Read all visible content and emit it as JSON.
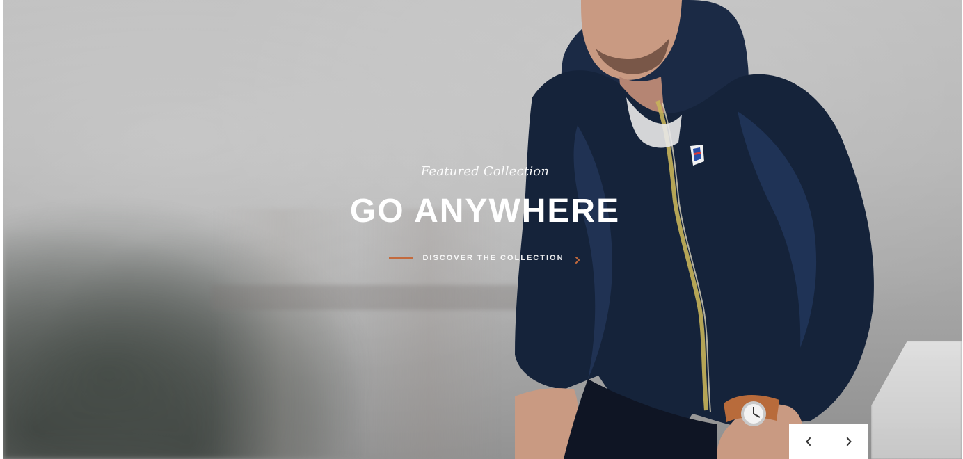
{
  "hero": {
    "eyebrow": "Featured Collection",
    "title": "GO ANYWHERE",
    "cta_label": "DISCOVER THE COLLECTION",
    "cta_arrow_icon": "chevron-right-icon"
  },
  "slider": {
    "prev_icon": "chevron-left-icon",
    "next_icon": "chevron-right-icon"
  },
  "colors": {
    "accent": "#c36a3d",
    "jacket": "#15233a",
    "white": "#ffffff"
  }
}
